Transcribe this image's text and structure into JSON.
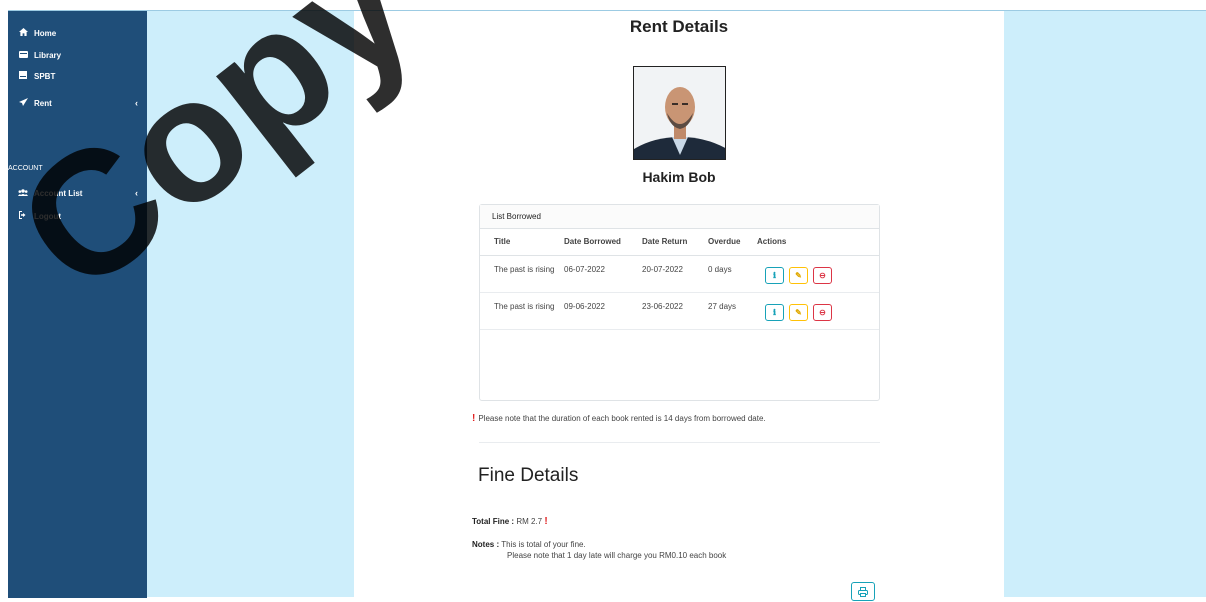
{
  "sidebar": {
    "items": [
      {
        "label": "Home",
        "icon": "home-icon"
      },
      {
        "label": "Library",
        "icon": "library-icon"
      },
      {
        "label": "SPBT",
        "icon": "book-icon"
      },
      {
        "label": "Rent",
        "icon": "send-icon"
      }
    ],
    "section_label": "ACCOUNT",
    "account_items": [
      {
        "label": "Account List",
        "icon": "users-icon"
      },
      {
        "label": "Logout",
        "icon": "logout-icon"
      }
    ]
  },
  "page": {
    "title": "Rent Details",
    "person_name": "Hakim Bob"
  },
  "borrowed": {
    "card_title": "List Borrowed",
    "columns": [
      "Title",
      "Date Borrowed",
      "Date Return",
      "Overdue",
      "Actions"
    ],
    "rows": [
      {
        "title": "The past is rising",
        "date_borrowed": "06-07-2022",
        "date_return": "20-07-2022",
        "overdue": "0 days"
      },
      {
        "title": "The past is rising",
        "date_borrowed": "09-06-2022",
        "date_return": "23-06-2022",
        "overdue": "27 days"
      }
    ]
  },
  "note": "Please note that the duration of each book rented is 14 days from borrowed date.",
  "fine": {
    "title": "Fine Details",
    "total_label": "Total Fine :",
    "total_value": "RM 2.7",
    "notes_label": "Notes :",
    "notes_line1": "This is total of your fine.",
    "notes_line2": "Please note that 1 day late will charge you RM0.10 each book"
  },
  "watermark": "Copy",
  "colors": {
    "sidebar": "#1f4e79",
    "background": "#cdeefb",
    "info": "#17a2b8",
    "warning": "#ffc107",
    "danger": "#dc3545"
  }
}
